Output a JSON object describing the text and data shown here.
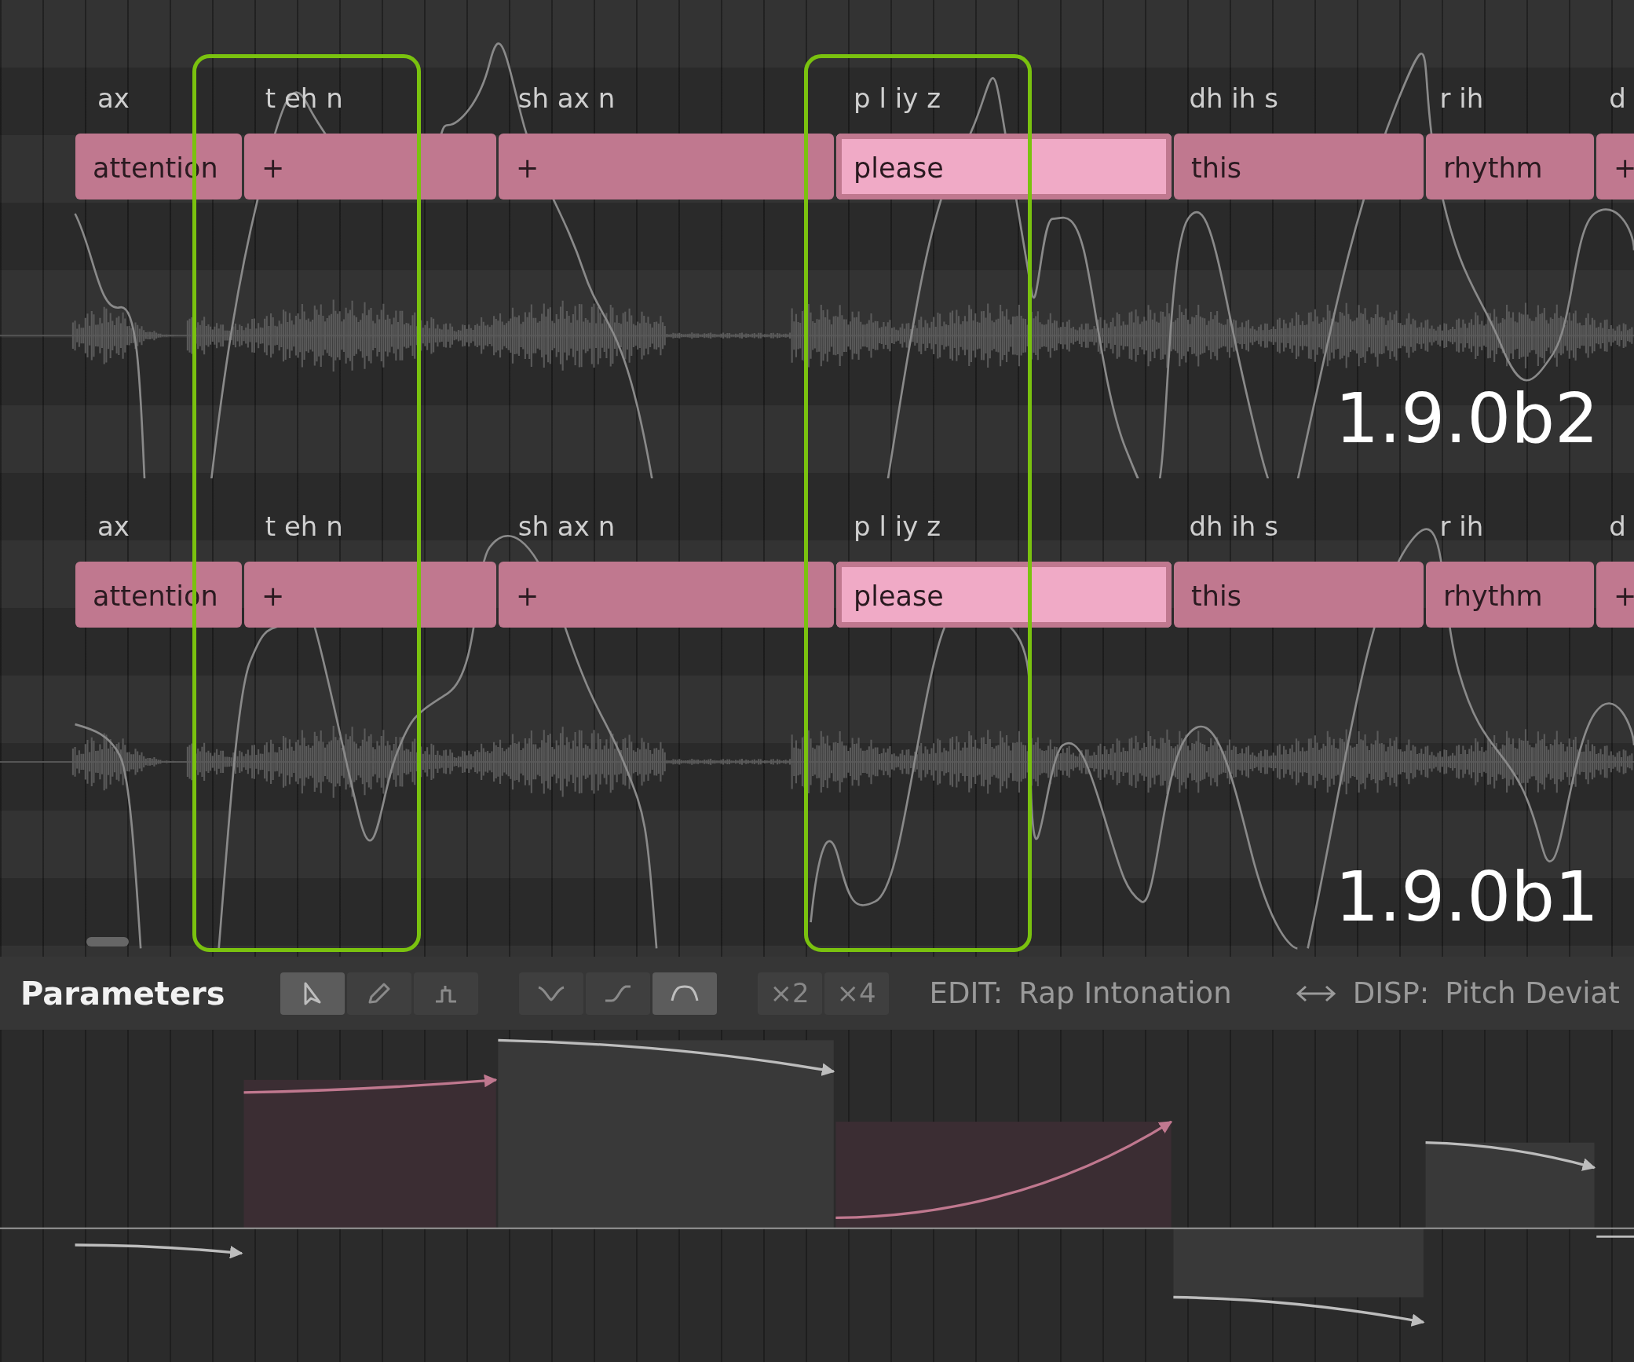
{
  "tracks": [
    {
      "version": "1.9.0b2",
      "notes": [
        {
          "phonemes": "ax",
          "lyric": "attention",
          "selected": false
        },
        {
          "phonemes": "t eh n",
          "lyric": "+",
          "selected": false
        },
        {
          "phonemes": "sh ax n",
          "lyric": "+",
          "selected": false
        },
        {
          "phonemes": "p l iy z",
          "lyric": "please",
          "selected": true
        },
        {
          "phonemes": "dh ih s",
          "lyric": "this",
          "selected": false
        },
        {
          "phonemes": "r ih",
          "lyric": "rhythm",
          "selected": false
        },
        {
          "phonemes": "d",
          "lyric": "+",
          "selected": false
        }
      ]
    },
    {
      "version": "1.9.0b1",
      "notes": [
        {
          "phonemes": "ax",
          "lyric": "attention",
          "selected": false
        },
        {
          "phonemes": "t eh n",
          "lyric": "+",
          "selected": false
        },
        {
          "phonemes": "sh ax n",
          "lyric": "+",
          "selected": false
        },
        {
          "phonemes": "p l iy z",
          "lyric": "please",
          "selected": true
        },
        {
          "phonemes": "dh ih s",
          "lyric": "this",
          "selected": false
        },
        {
          "phonemes": "r ih",
          "lyric": "rhythm",
          "selected": false
        },
        {
          "phonemes": "d",
          "lyric": "+",
          "selected": false
        }
      ]
    }
  ],
  "toolbar": {
    "title": "Parameters",
    "tools": [
      {
        "kind": "select",
        "selected": true
      },
      {
        "kind": "pencil",
        "selected": false
      },
      {
        "kind": "step",
        "selected": false
      }
    ],
    "curves": [
      {
        "kind": "dip",
        "selected": false
      },
      {
        "kind": "rise",
        "selected": false
      },
      {
        "kind": "arch",
        "selected": true
      }
    ],
    "multipliers": [
      "×2",
      "×4"
    ],
    "edit_label": "EDIT:",
    "edit_value": "Rap Intonation",
    "disp_label": "DISP:",
    "disp_value": "Pitch Deviat"
  }
}
